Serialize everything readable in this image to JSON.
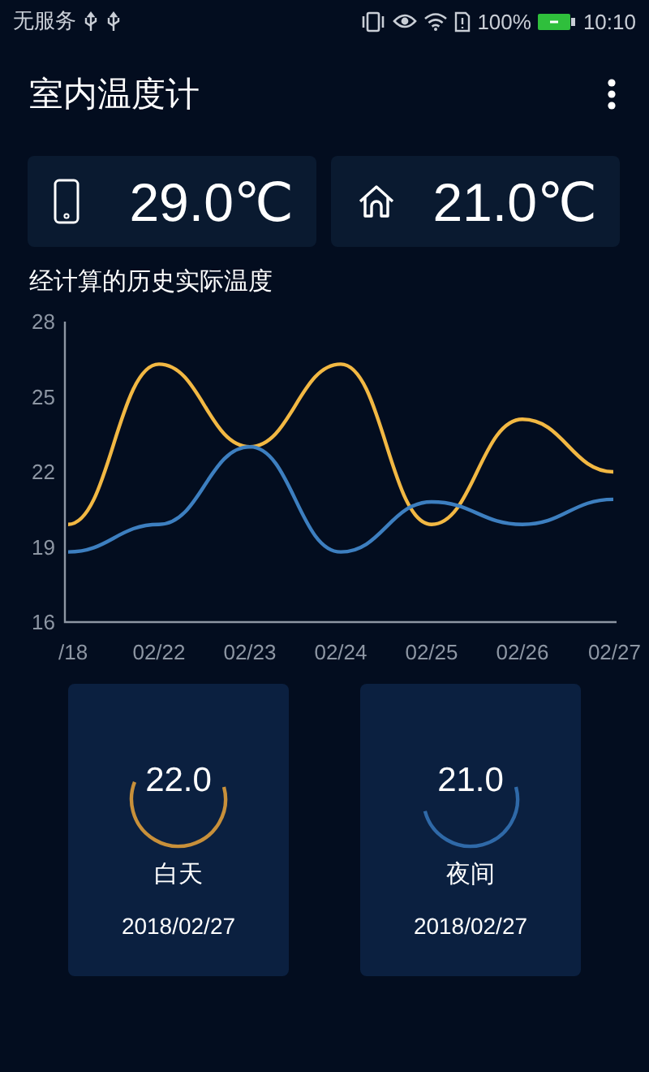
{
  "status_bar": {
    "carrier": "无服务",
    "battery_percent": "100%",
    "time": "10:10"
  },
  "app_bar": {
    "title": "室内温度计"
  },
  "readings": [
    {
      "kind": "phone",
      "value": "29.0℃"
    },
    {
      "kind": "home",
      "value": "21.0℃"
    }
  ],
  "history": {
    "title": "经计算的历史实际温度",
    "chart_data": {
      "type": "line",
      "categories": [
        "/18",
        "02/22",
        "02/23",
        "02/24",
        "02/25",
        "02/26",
        "02/27"
      ],
      "ylim": [
        16,
        28
      ],
      "yticks": [
        16,
        19,
        22,
        25,
        28
      ],
      "series": [
        {
          "color": "#f2b843",
          "values": [
            19.9,
            26.3,
            23.0,
            26.3,
            19.9,
            24.1,
            22.0
          ]
        },
        {
          "color": "#3d7fc0",
          "values": [
            18.8,
            19.9,
            23.0,
            18.8,
            20.8,
            19.9,
            20.9
          ]
        }
      ]
    }
  },
  "gauges": [
    {
      "value": "22.0",
      "label": "白天",
      "date": "2018/02/27",
      "color": "#c8903a",
      "level": 0.6
    },
    {
      "value": "21.0",
      "label": "夜间",
      "date": "2018/02/27",
      "color": "#2f69a8",
      "level": 0.5
    }
  ]
}
